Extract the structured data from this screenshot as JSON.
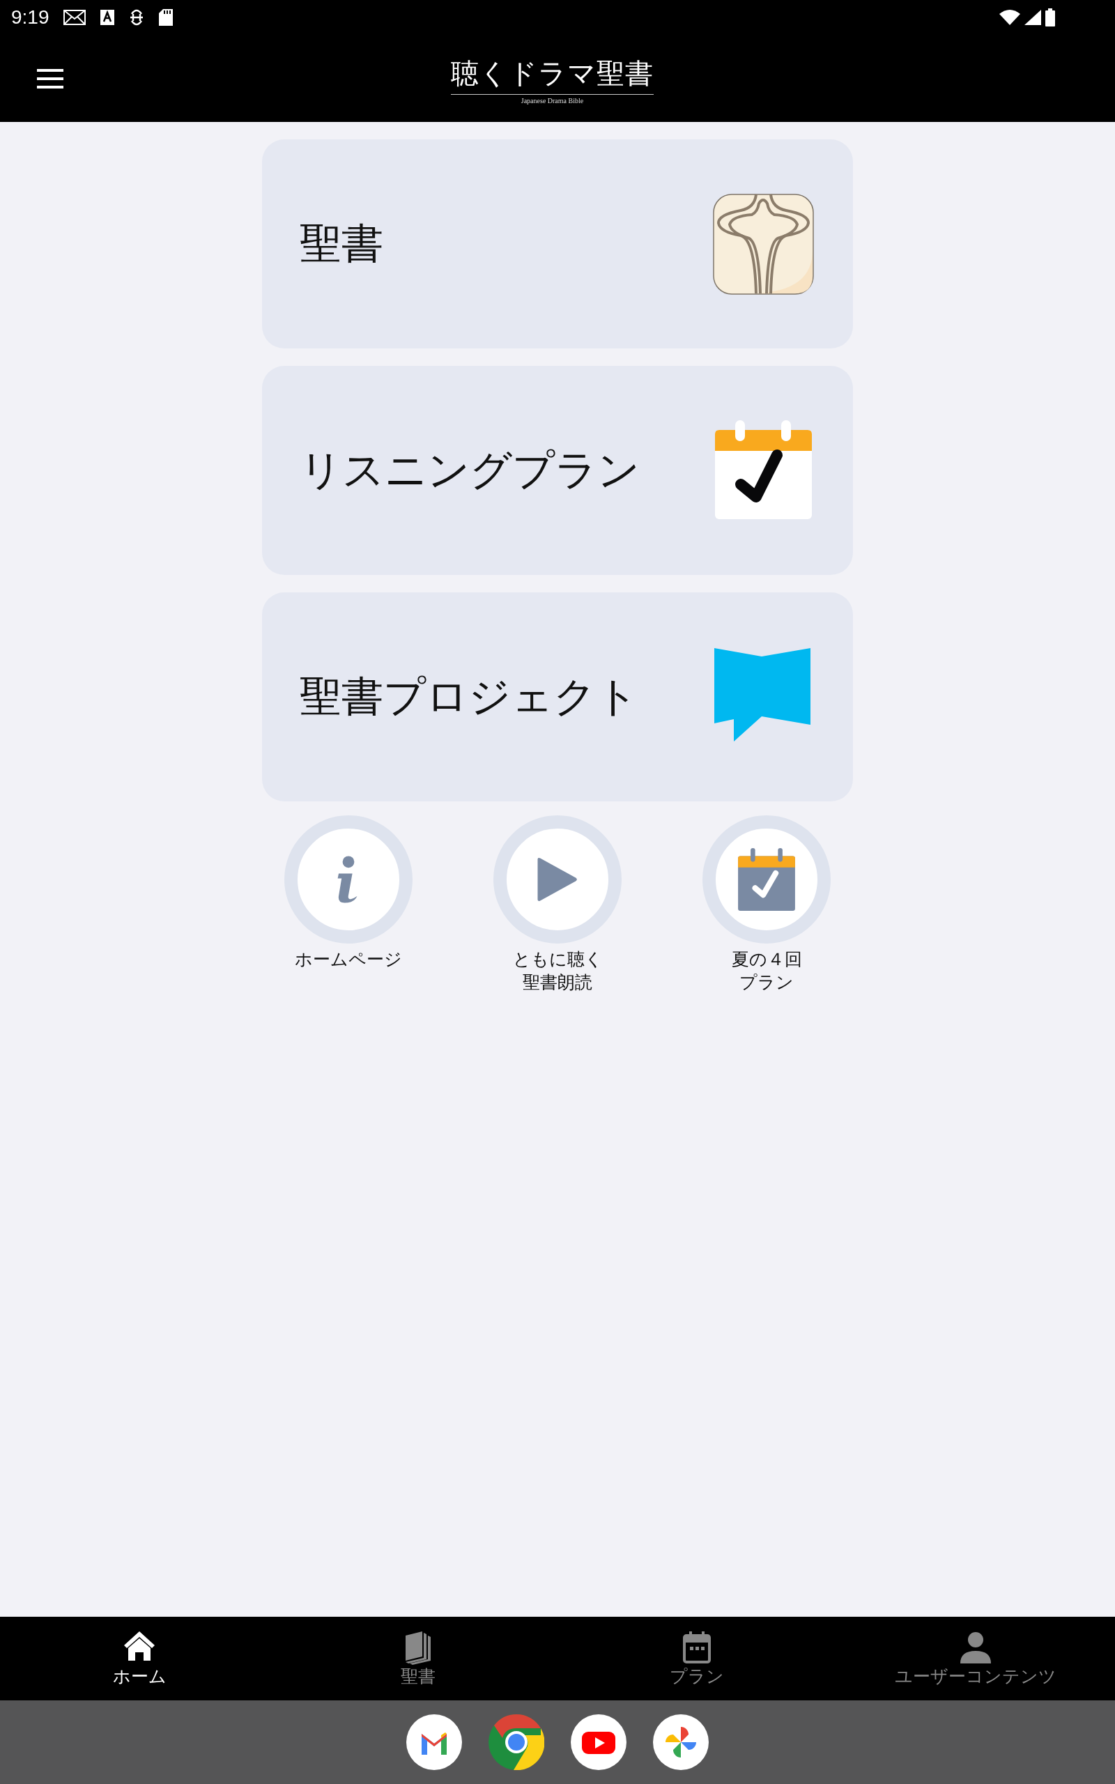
{
  "status_bar": {
    "time": "9:19"
  },
  "app_bar": {
    "title": "聴くドラマ聖書",
    "subtitle": "Japanese Drama Bible"
  },
  "cards": [
    {
      "label": "聖書",
      "kind": "bible"
    },
    {
      "label": "リスニングプラン",
      "kind": "calendar"
    },
    {
      "label": "聖書プロジェクト",
      "kind": "flag"
    }
  ],
  "shortcuts": [
    {
      "label_lines": [
        "ホームページ"
      ],
      "kind": "info"
    },
    {
      "label_lines": [
        "ともに聴く",
        "聖書朗読"
      ],
      "kind": "play"
    },
    {
      "label_lines": [
        "夏の４回",
        "プラン"
      ],
      "kind": "calendar"
    }
  ],
  "bottom_nav": [
    {
      "label": "ホーム",
      "kind": "home",
      "selected": true
    },
    {
      "label": "聖書",
      "kind": "book",
      "selected": false
    },
    {
      "label": "プラン",
      "kind": "calendar",
      "selected": false
    },
    {
      "label": "ユーザーコンテンツ",
      "kind": "person",
      "selected": false
    }
  ],
  "dock": [
    {
      "kind": "mail"
    },
    {
      "kind": "browser"
    },
    {
      "kind": "video"
    },
    {
      "kind": "photos"
    }
  ]
}
